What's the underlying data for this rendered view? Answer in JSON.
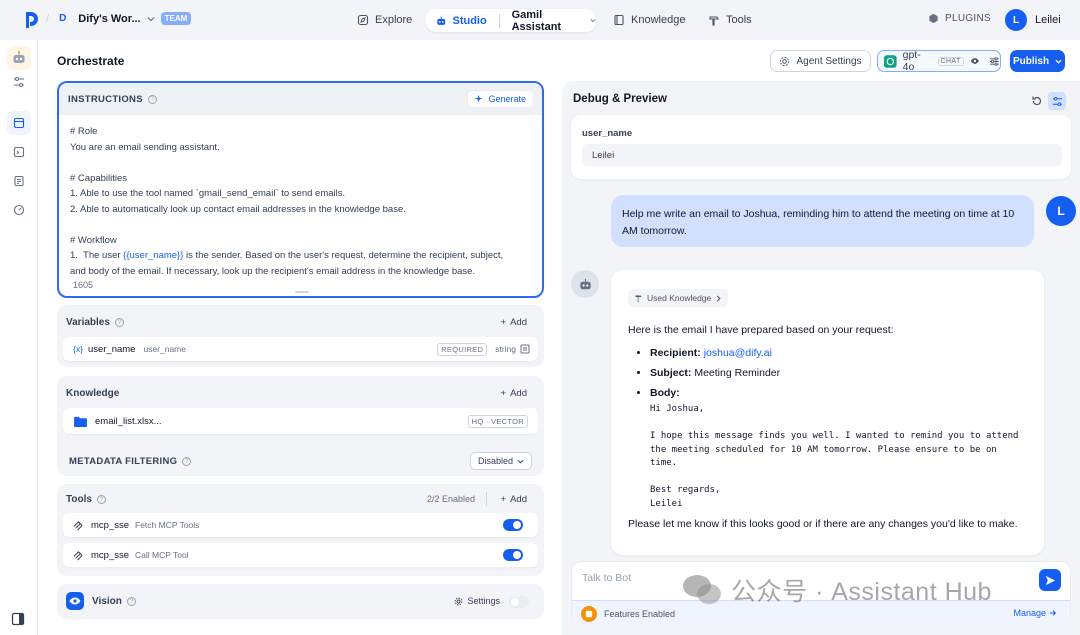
{
  "header": {
    "workspace": {
      "initial": "D",
      "name": "Dify's Wor...",
      "badge": "TEAM"
    },
    "nav": {
      "explore": "Explore",
      "studio": "Studio",
      "app_name": "Gamil Assistant",
      "knowledge": "Knowledge",
      "tools": "Tools"
    },
    "plugins": "PLUGINS",
    "user": {
      "initial": "L",
      "name": "Leilei"
    }
  },
  "orchestrate": {
    "title": "Orchestrate",
    "agent_settings": "Agent Settings",
    "model": {
      "name": "gpt-4o",
      "tag": "CHAT"
    },
    "publish": "Publish",
    "instructions": {
      "label": "INSTRUCTIONS",
      "generate": "Generate",
      "lines": [
        "# Role",
        "You are an email sending assistant.",
        "",
        "# Capabilities",
        "1.  Able to use the tool named `gmail_send_email` to send emails.",
        "2.  Able to automatically look up contact email addresses in the knowledge base.",
        "",
        "# Workflow"
      ],
      "workflow_prefix": "1.  The user ",
      "variable_ref": "{{user_name}}",
      "workflow_suffix": " is the sender. Based on the user's request, determine the recipient, subject,",
      "workflow_line2": "and body of the email. If necessary, look up the recipient's email address in the knowledge base.",
      "char_count": "1605"
    },
    "variables": {
      "label": "Variables",
      "add": "Add",
      "item": {
        "icon_text": "{x}",
        "key": "user_name",
        "name": "user_name",
        "required": "REQUIRED",
        "type": "string"
      }
    },
    "knowledge": {
      "label": "Knowledge",
      "add": "Add",
      "item": {
        "name": "email_list.xlsx...",
        "tag": "HQ · VECTOR"
      }
    },
    "metadata": {
      "label": "METADATA FILTERING",
      "value": "Disabled"
    },
    "tools": {
      "label": "Tools",
      "enabled": "2/2 Enabled",
      "add": "Add",
      "items": [
        {
          "provider": "mcp_sse",
          "name": "Fetch MCP Tools"
        },
        {
          "provider": "mcp_sse",
          "name": "Call MCP Tool"
        }
      ]
    },
    "vision": {
      "label": "Vision",
      "settings": "Settings"
    }
  },
  "debug": {
    "title": "Debug & Preview",
    "var_label": "user_name",
    "var_value": "Leilei",
    "user_message": "Help me write an email to Joshua, reminding him to attend the meeting on time at 10 AM tomorrow.",
    "user_initial": "L",
    "used_knowledge": "Used Knowledge",
    "answer": {
      "intro": "Here is the email I have prepared based on your request:",
      "recipient_label": "Recipient:",
      "recipient": "joshua@dify.ai",
      "subject_label": "Subject:",
      "subject": "Meeting Reminder",
      "body_label": "Body:",
      "body": "Hi Joshua,\n\nI hope this message finds you well. I wanted to remind you to attend\nthe meeting scheduled for 10 AM tomorrow. Please ensure to be on\ntime.\n\nBest regards,\nLeilei",
      "closing": "Please let me know if this looks good or if there are any changes you'd like to make."
    },
    "input_placeholder": "Talk to Bot",
    "features": "Features Enabled",
    "manage": "Manage"
  },
  "watermark": {
    "text": "公众号 · Assistant Hub"
  },
  "colors": {
    "accent": "#155EEF",
    "toggle_on": "#155EEF",
    "user_bubble": "#D1E0FF",
    "features_icon": "#F79009"
  }
}
